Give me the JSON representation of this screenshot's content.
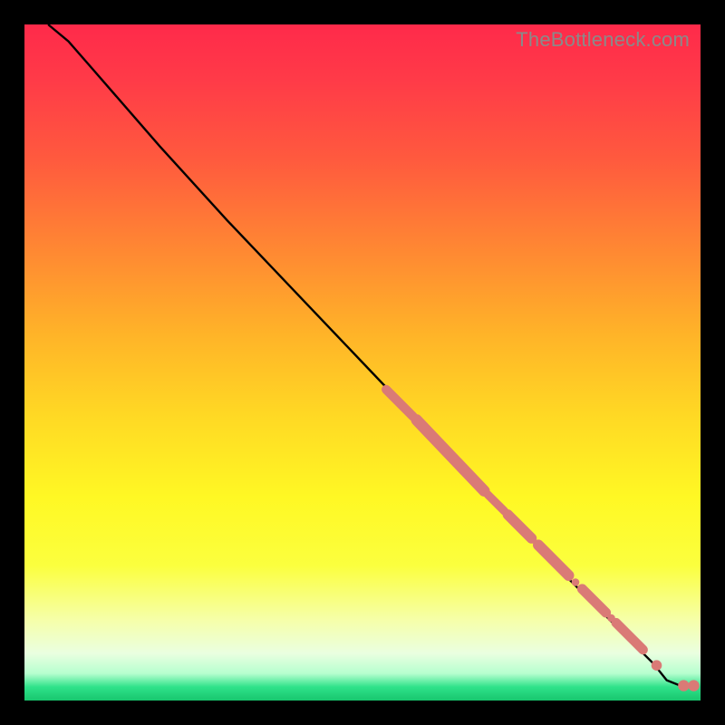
{
  "attribution": "TheBottleneck.com",
  "chart_data": {
    "type": "line",
    "title": "",
    "xlabel": "",
    "ylabel": "",
    "xlim": [
      0,
      100
    ],
    "ylim": [
      0,
      100
    ],
    "curve": [
      {
        "x": 3.5,
        "y": 100.0
      },
      {
        "x": 6.5,
        "y": 97.5
      },
      {
        "x": 10.0,
        "y": 93.5
      },
      {
        "x": 20.0,
        "y": 82.0
      },
      {
        "x": 30.0,
        "y": 71.0
      },
      {
        "x": 40.0,
        "y": 60.5
      },
      {
        "x": 50.0,
        "y": 50.0
      },
      {
        "x": 60.0,
        "y": 39.5
      },
      {
        "x": 70.0,
        "y": 29.0
      },
      {
        "x": 80.0,
        "y": 18.5
      },
      {
        "x": 88.0,
        "y": 10.5
      },
      {
        "x": 93.0,
        "y": 5.5
      },
      {
        "x": 95.0,
        "y": 3.0
      },
      {
        "x": 97.5,
        "y": 2.0
      },
      {
        "x": 99.0,
        "y": 2.0
      }
    ],
    "segments": [
      {
        "x0": 53.5,
        "y0": 46.0,
        "x1": 57.5,
        "y1": 42.0,
        "w": 4.2
      },
      {
        "x0": 58.0,
        "y0": 41.5,
        "x1": 68.0,
        "y1": 31.0,
        "w": 5.2
      },
      {
        "x0": 68.5,
        "y0": 30.5,
        "x1": 71.0,
        "y1": 28.0,
        "w": 3.8
      },
      {
        "x0": 71.5,
        "y0": 27.5,
        "x1": 75.0,
        "y1": 24.0,
        "w": 4.8
      },
      {
        "x0": 76.0,
        "y0": 23.0,
        "x1": 80.5,
        "y1": 18.5,
        "w": 5.0
      },
      {
        "x0": 82.5,
        "y0": 16.5,
        "x1": 86.0,
        "y1": 13.0,
        "w": 4.6
      },
      {
        "x0": 87.5,
        "y0": 11.5,
        "x1": 91.5,
        "y1": 7.5,
        "w": 4.4
      }
    ],
    "dots": [
      {
        "x": 81.5,
        "y": 17.5,
        "r": 1.8
      },
      {
        "x": 86.8,
        "y": 12.2,
        "r": 1.8
      },
      {
        "x": 91.0,
        "y": 8.0,
        "r": 2.0
      },
      {
        "x": 93.5,
        "y": 5.2,
        "r": 2.4
      },
      {
        "x": 97.5,
        "y": 2.2,
        "r": 2.6
      },
      {
        "x": 99.0,
        "y": 2.2,
        "r": 2.6
      }
    ],
    "marker_color": "#da7a76",
    "curve_color": "#000000"
  }
}
